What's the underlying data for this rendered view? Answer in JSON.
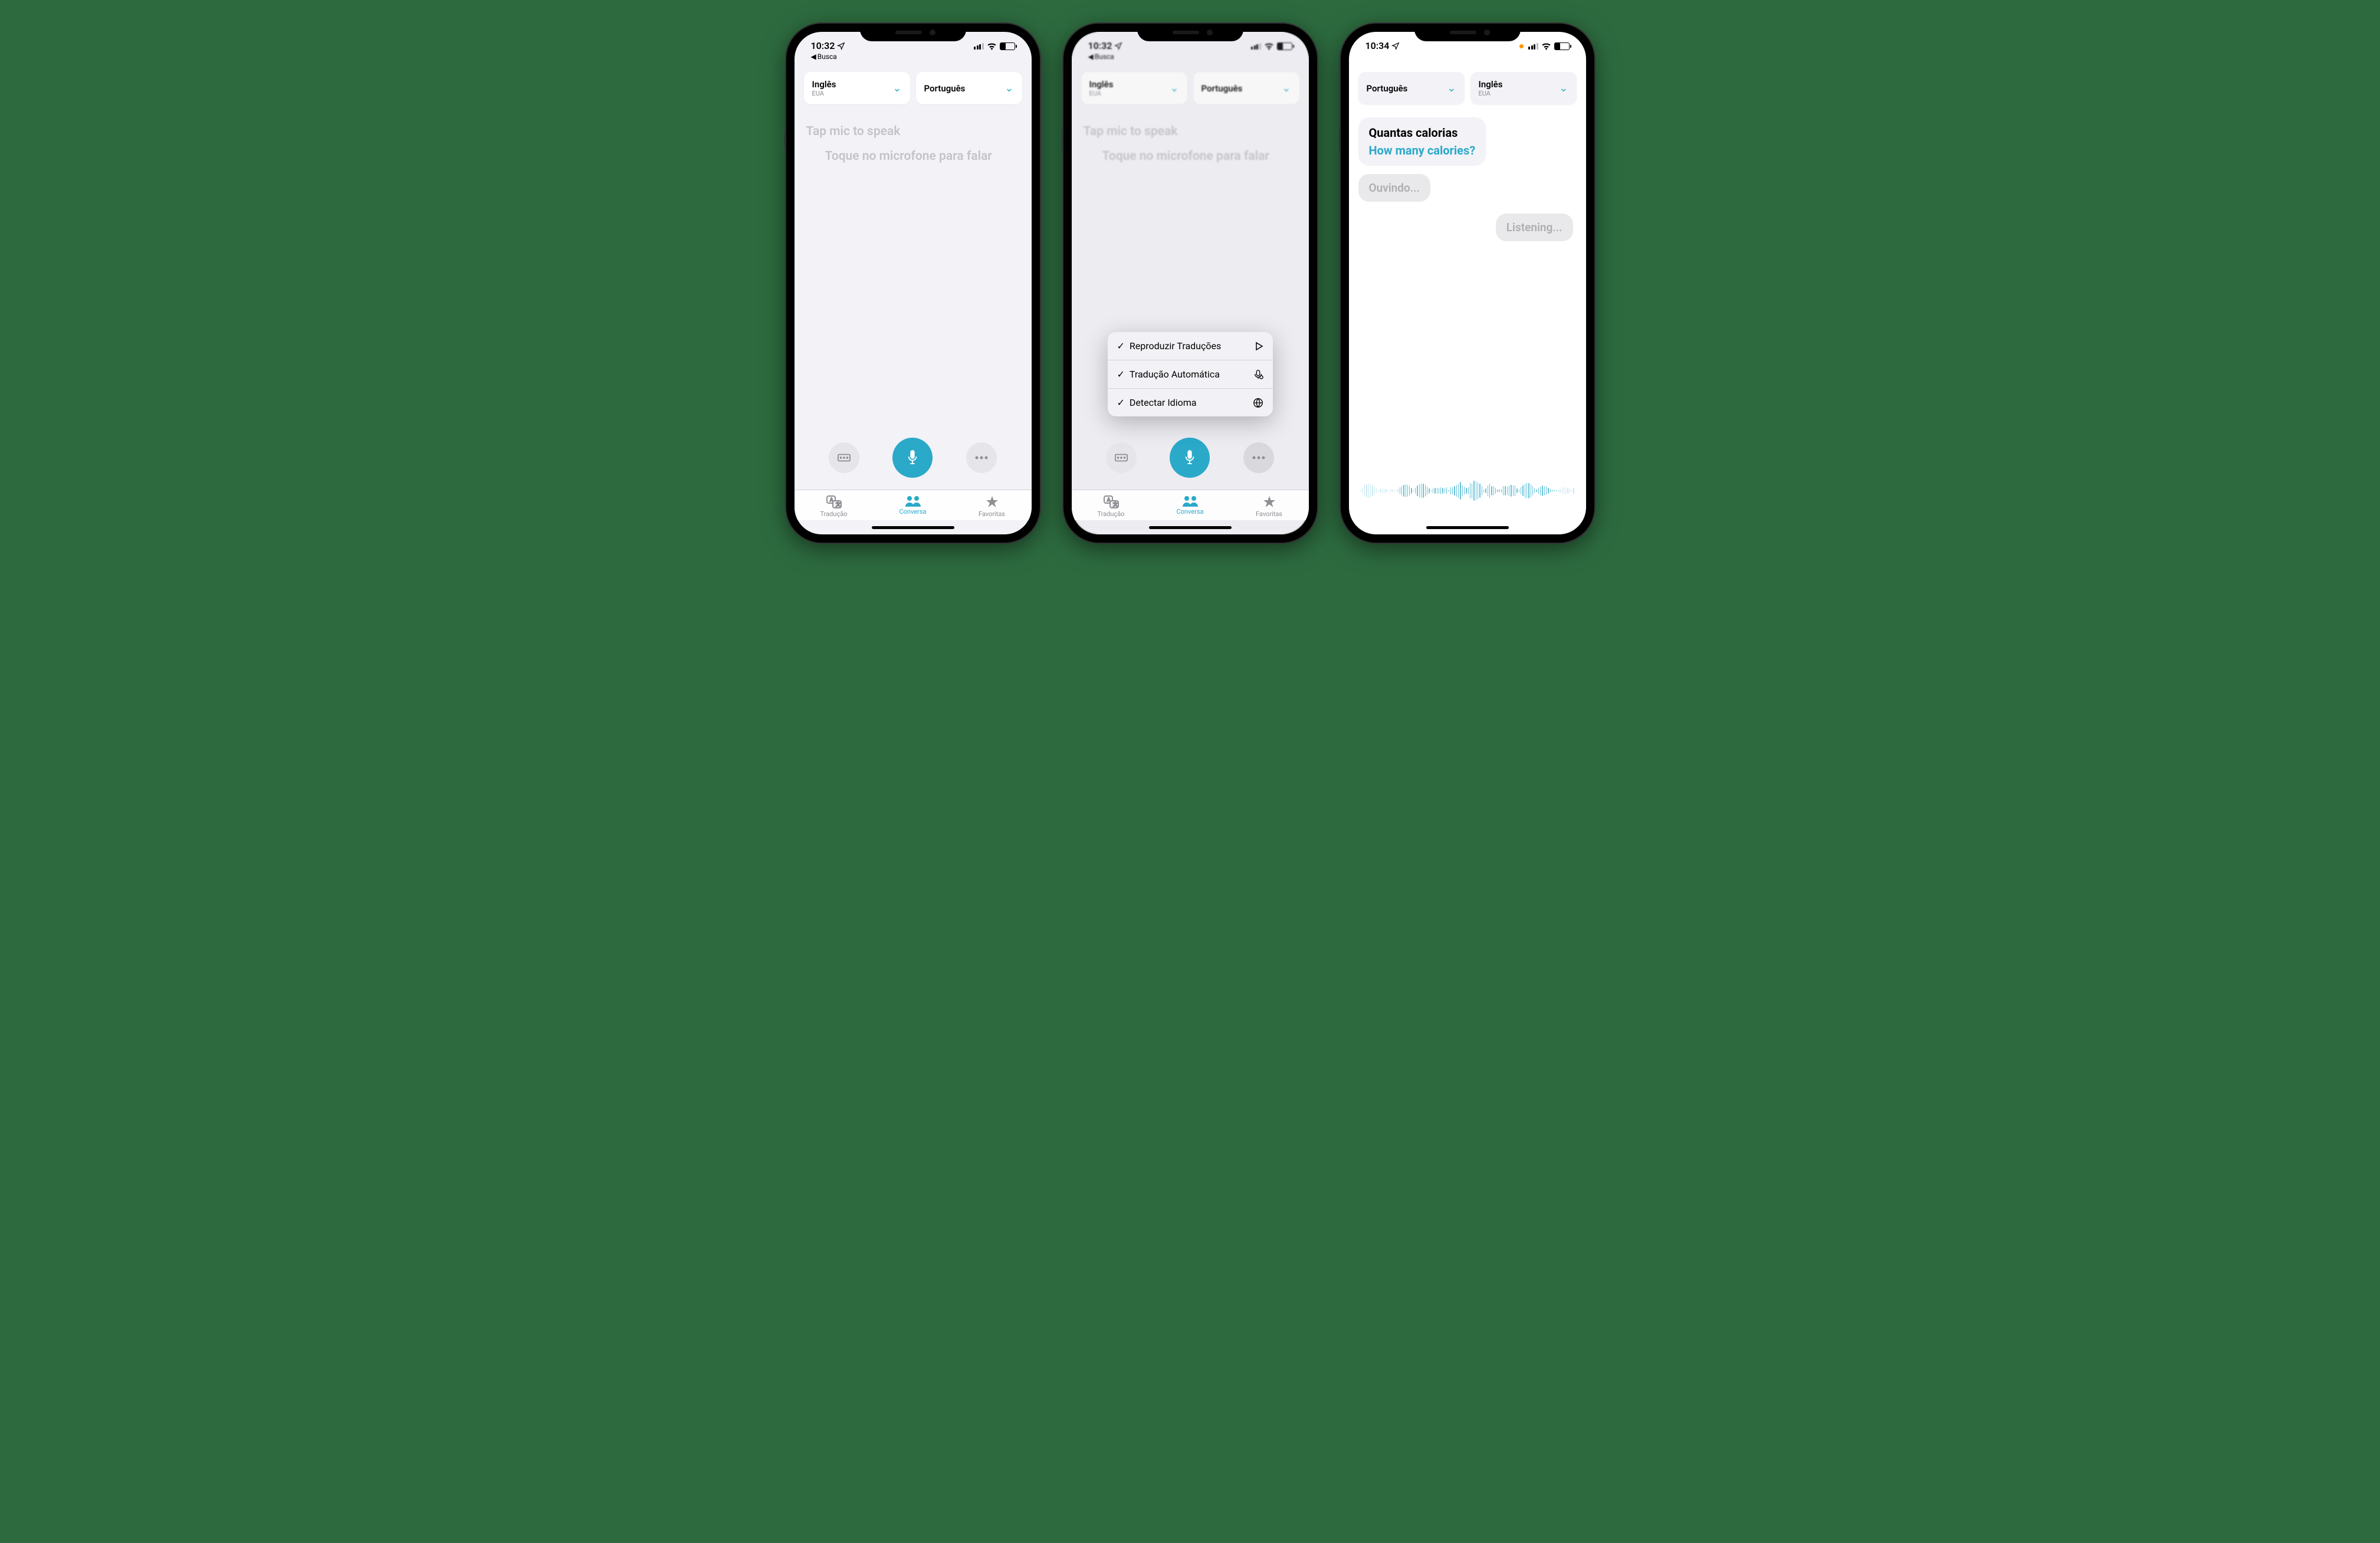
{
  "colors": {
    "accent": "#2aa9c9",
    "bg": "#f2f2f7",
    "frame_bg": "#2d6b3f"
  },
  "phones": [
    {
      "status": {
        "time": "10:32",
        "back": "Busca",
        "show_back": true,
        "show_orange_dot": false
      },
      "langs": [
        {
          "name": "Inglês",
          "sub": "EUA"
        },
        {
          "name": "Português",
          "sub": ""
        }
      ],
      "hints": {
        "primary": "Tap mic to speak",
        "secondary": "Toque no microfone para falar"
      },
      "tabs": [
        {
          "label": "Tradução",
          "active": false
        },
        {
          "label": "Conversa",
          "active": true
        },
        {
          "label": "Favoritas",
          "active": false
        }
      ]
    },
    {
      "status": {
        "time": "10:32",
        "back": "Busca",
        "show_back": true,
        "show_orange_dot": false
      },
      "langs": [
        {
          "name": "Inglês",
          "sub": "EUA"
        },
        {
          "name": "Português",
          "sub": ""
        }
      ],
      "hints": {
        "primary": "Tap mic to speak",
        "secondary": "Toque no microfone para falar"
      },
      "menu": [
        {
          "label": "Reproduzir Traduções",
          "checked": true,
          "icon": "play"
        },
        {
          "label": "Tradução Automática",
          "checked": true,
          "icon": "mic-auto"
        },
        {
          "label": "Detectar Idioma",
          "checked": true,
          "icon": "globe"
        }
      ],
      "tabs": [
        {
          "label": "Tradução",
          "active": false
        },
        {
          "label": "Conversa",
          "active": true
        },
        {
          "label": "Favoritas",
          "active": false
        }
      ]
    },
    {
      "status": {
        "time": "10:34",
        "back": "",
        "show_back": false,
        "show_orange_dot": true
      },
      "langs": [
        {
          "name": "Português",
          "sub": ""
        },
        {
          "name": "Inglês",
          "sub": "EUA"
        }
      ],
      "conversation": {
        "source": "Quantas calorias",
        "target": "How many calories?",
        "listening_left": "Ouvindo...",
        "listening_right": "Listening..."
      }
    }
  ]
}
